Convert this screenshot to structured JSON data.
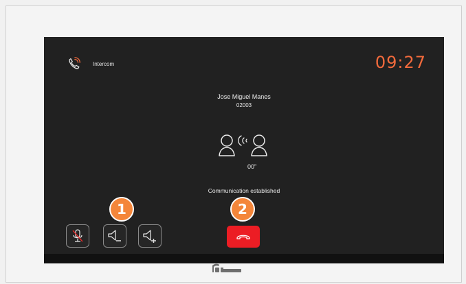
{
  "header": {
    "call_type_icon": "phone-ringing-icon",
    "call_type_label": "Intercom",
    "clock": "09:27"
  },
  "caller": {
    "name": "Jose Miguel Manes",
    "id": "02003"
  },
  "call": {
    "duration": "00”",
    "status": "Communication established",
    "icon": "two-people-talking-icon"
  },
  "controls": {
    "mute_icon": "microphone-muted-icon",
    "volume_down_icon": "speaker-volume-down-icon",
    "volume_up_icon": "speaker-volume-up-icon",
    "hangup_icon": "hang-up-phone-icon"
  },
  "markers": [
    "1",
    "2"
  ],
  "brand": {
    "logo": "fermax-logo"
  },
  "colors": {
    "accent": "#f26a3c",
    "hangup": "#ec1d24",
    "marker": "#f4863a",
    "screen_bg": "#212121",
    "mute_slash": "#e52b2b"
  }
}
